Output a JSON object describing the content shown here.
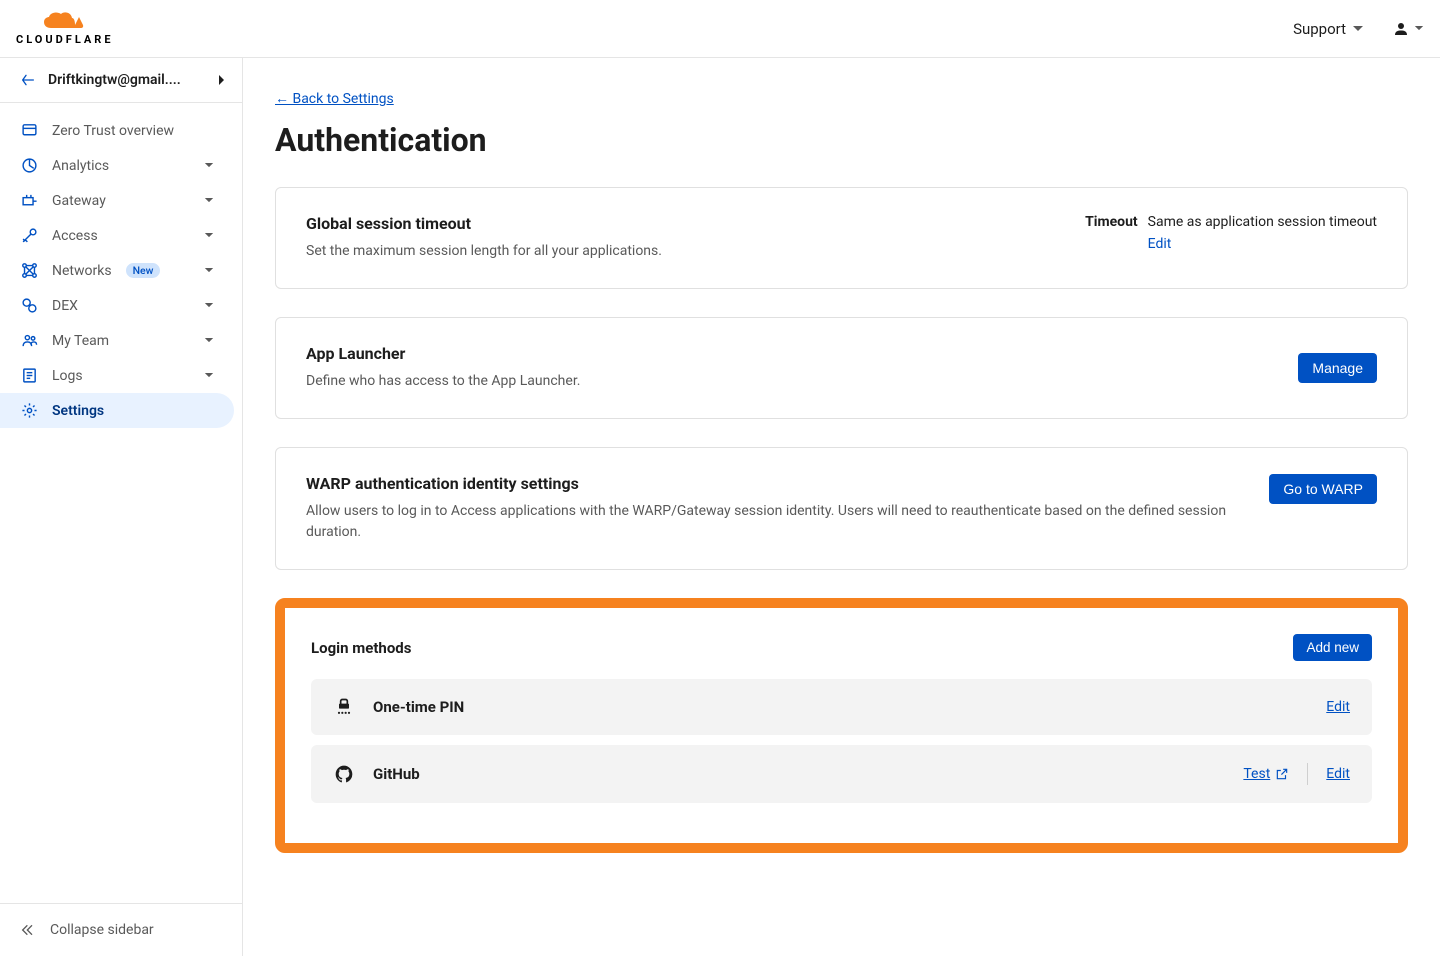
{
  "header": {
    "brand": "CLOUDFLARE",
    "support": "Support"
  },
  "sidebar": {
    "account": "Driftkingtw@gmail....",
    "items": [
      {
        "label": "Zero Trust overview",
        "icon": "browser",
        "expandable": false
      },
      {
        "label": "Analytics",
        "icon": "analytics",
        "expandable": true
      },
      {
        "label": "Gateway",
        "icon": "gateway",
        "expandable": true
      },
      {
        "label": "Access",
        "icon": "access",
        "expandable": true
      },
      {
        "label": "Networks",
        "icon": "networks",
        "expandable": true,
        "badge": "New"
      },
      {
        "label": "DEX",
        "icon": "dex",
        "expandable": true
      },
      {
        "label": "My Team",
        "icon": "myteam",
        "expandable": true
      },
      {
        "label": "Logs",
        "icon": "logs",
        "expandable": true
      },
      {
        "label": "Settings",
        "icon": "settings",
        "expandable": false,
        "active": true
      }
    ],
    "collapse": "Collapse sidebar"
  },
  "main": {
    "backLink": "← Back to Settings",
    "title": "Authentication",
    "global": {
      "title": "Global session timeout",
      "desc": "Set the maximum session length for all your applications.",
      "timeout_label": "Timeout",
      "timeout_value": "Same as application session timeout",
      "edit": "Edit"
    },
    "appLauncher": {
      "title": "App Launcher",
      "desc": "Define who has access to the App Launcher.",
      "button": "Manage"
    },
    "warp": {
      "title": "WARP authentication identity settings",
      "desc": "Allow users to log in to Access applications with the WARP/Gateway session identity. Users will need to reauthenticate based on the defined session duration.",
      "button": "Go to WARP"
    },
    "loginMethods": {
      "title": "Login methods",
      "addButton": "Add new",
      "methods": [
        {
          "name": "One-time PIN",
          "icon": "pin",
          "test": false,
          "edit": "Edit"
        },
        {
          "name": "GitHub",
          "icon": "github",
          "test": true,
          "testLabel": "Test",
          "edit": "Edit"
        }
      ]
    }
  }
}
